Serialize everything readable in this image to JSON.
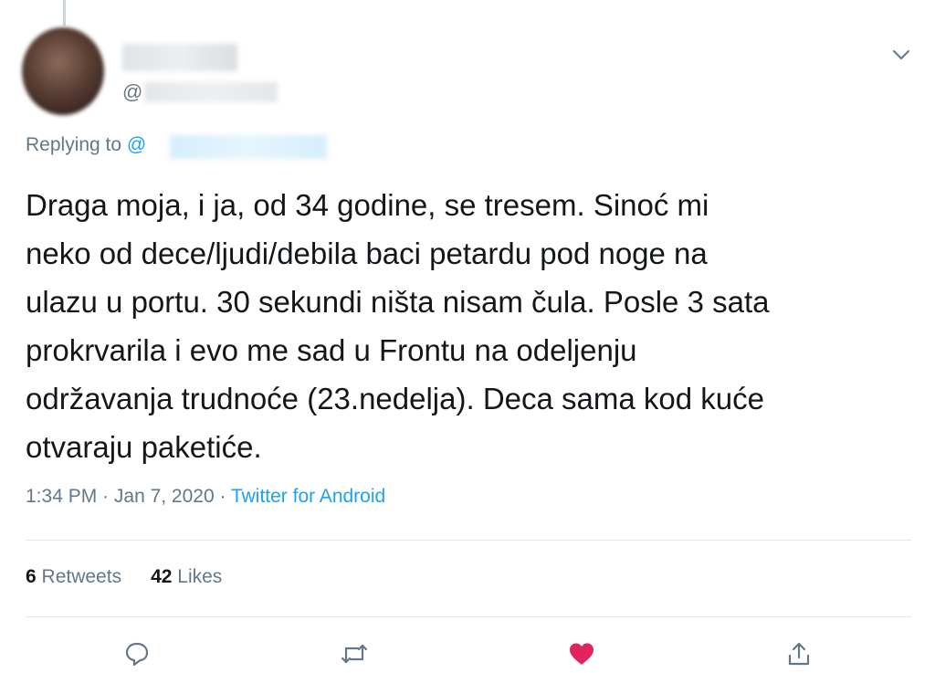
{
  "tweet": {
    "handle_prefix": "@",
    "replying_to_label": "Replying to",
    "replying_to_prefix": "@",
    "text_lines": [
      "Draga moja, i ja, od 34 godine, se tresem. Sinoć mi",
      "neko od dece/ljudi/debila baci petardu pod noge na",
      "ulazu u portu. 30 sekundi ništa nisam čula. Posle 3 sata",
      "prokrvarila i evo me sad u Frontu na odeljenju",
      "održavanja trudnoće (23.nedelja). Deca sama kod kuće",
      "otvaraju paketiće."
    ],
    "time": "1:34 PM",
    "separator": " · ",
    "date": "Jan 7, 2020",
    "source": "Twitter for Android",
    "retweets_count": "6",
    "retweets_label": "Retweets",
    "likes_count": "42",
    "likes_label": "Likes"
  },
  "icons": {
    "caret": "chevron-down-icon",
    "reply": "reply-icon",
    "retweet": "retweet-icon",
    "like": "heart-icon",
    "share": "share-icon"
  },
  "colors": {
    "accent": "#1da1f2",
    "like": "#e0245e",
    "secondary_text": "#657786",
    "divider": "#e1e8ed"
  }
}
